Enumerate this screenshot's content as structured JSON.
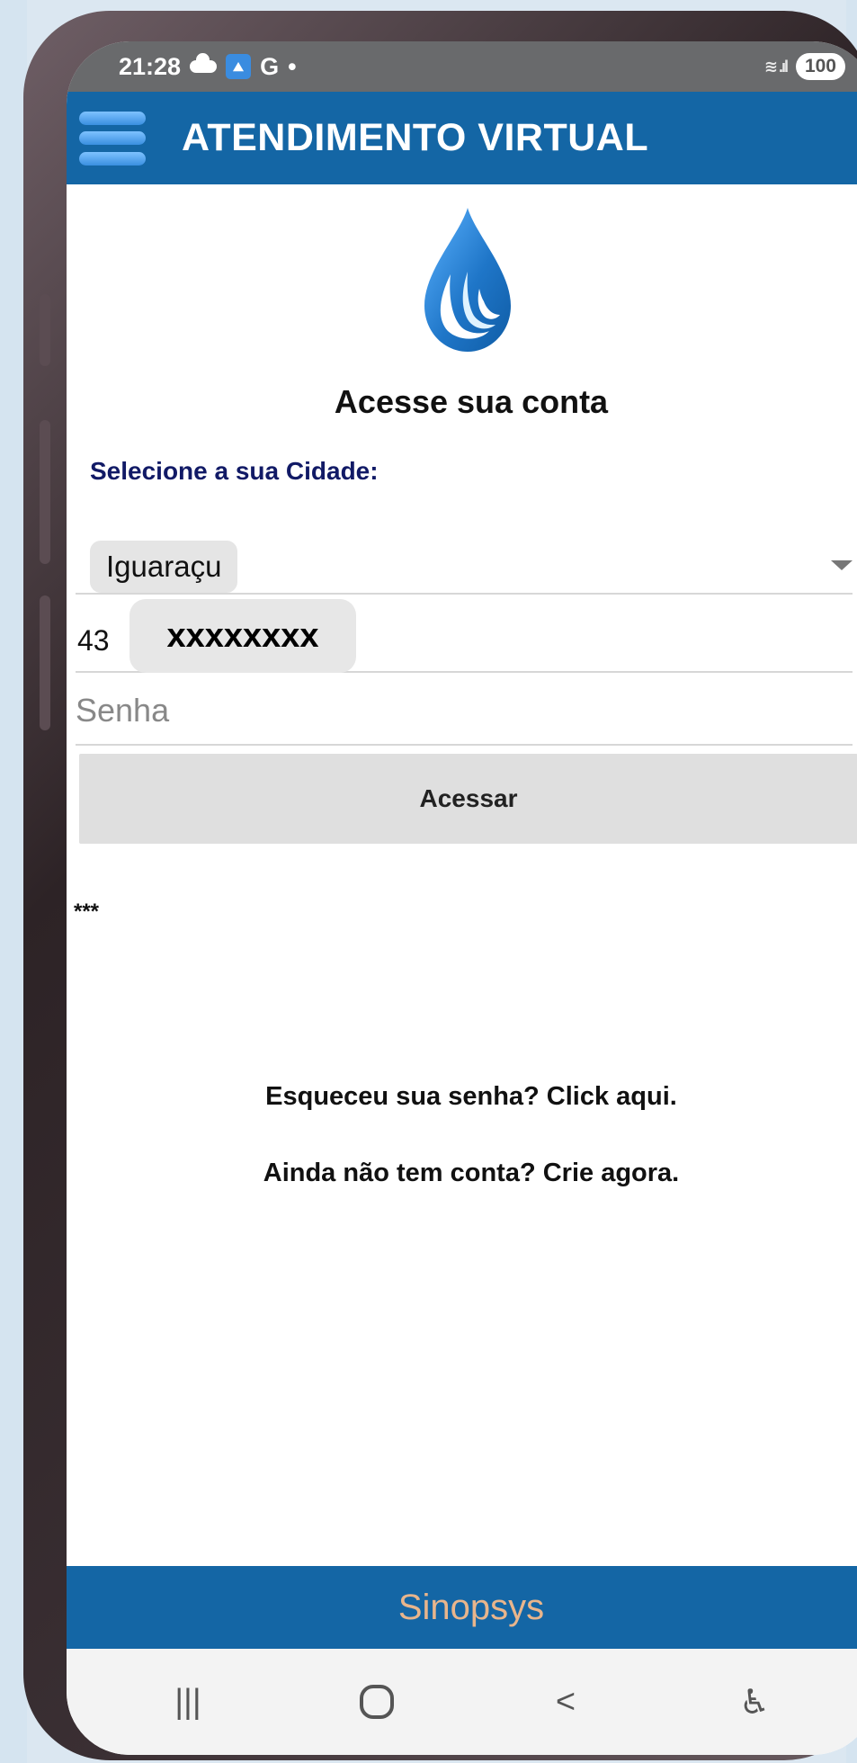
{
  "status_bar": {
    "time": "21:28",
    "app_icon": "mountain-app-icon",
    "google_label": "G",
    "dot": "•",
    "wifi_signal": "wifi-signal-icon",
    "battery_level": "100"
  },
  "app_header": {
    "title": "ATENDIMENTO VIRTUAL",
    "menu_icon": "hamburger-menu-icon"
  },
  "logo": {
    "name": "water-drop-logo",
    "accent_color": "#1c78c8"
  },
  "login": {
    "title": "Acesse sua conta",
    "city_label": "Selecione a sua Cidade:",
    "city_value": "Iguaraçu",
    "user_prefix": "43",
    "user_masked": "xxxxxxxx",
    "password_placeholder": "Senha",
    "submit_label": "Acessar",
    "asterisks": "***",
    "forgot_password": "Esqueceu sua senha? Click aqui.",
    "signup": "Ainda não tem conta? Crie agora."
  },
  "footer": {
    "brand": "Sinopsys"
  },
  "nav_bar": {
    "recent_apps_icon": "recent-apps-icon",
    "home_icon": "home-circle-icon",
    "back_icon": "back-arrow-icon",
    "accessibility_icon": "accessibility-icon",
    "recent_apps_symbol": "|||",
    "back_symbol": "<",
    "accessibility_symbol": "♿"
  },
  "colors": {
    "header_blue": "#1466a5",
    "footer_brand": "#e8b58c",
    "button_gray": "#dfdfdf",
    "status_gray": "#696a6c"
  }
}
